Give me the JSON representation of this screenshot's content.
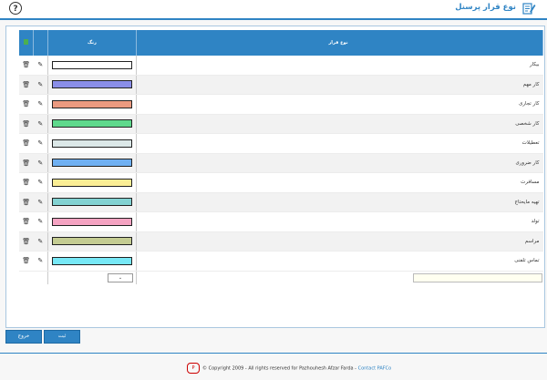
{
  "header": {
    "title": "نوع قرار پرسنل",
    "help_icon": "question-circle-icon",
    "title_icon": "edit-document-icon"
  },
  "grid": {
    "col_name": "نوع قرار",
    "col_color": "رنگ",
    "rows": [
      {
        "name": "بیکار",
        "color": "#ffffff"
      },
      {
        "name": "کار مهم",
        "color": "#8a8ee8"
      },
      {
        "name": "کار تجاری",
        "color": "#eb9a80"
      },
      {
        "name": "کار شخصی",
        "color": "#5fd98c"
      },
      {
        "name": "تعطیلات",
        "color": "#dce8e8"
      },
      {
        "name": "کار ضروری",
        "color": "#6fb0f2"
      },
      {
        "name": "مسافرت",
        "color": "#fbee95"
      },
      {
        "name": "تهیه مایحتاج",
        "color": "#82d2d2"
      },
      {
        "name": "تولد",
        "color": "#f5a3c2"
      },
      {
        "name": "مراسم",
        "color": "#c4cc92"
      },
      {
        "name": "تماس تلفنی",
        "color": "#77e8f6"
      }
    ],
    "new_color_select": "⌄"
  },
  "buttons": {
    "submit": "ثبت",
    "exit": "خروج"
  },
  "footer": {
    "logo": "P",
    "text": "© Copyright 2009 - All rights reserved for Pazhouhesh Afzar Farda -",
    "contact": "Contact PAFCo"
  }
}
